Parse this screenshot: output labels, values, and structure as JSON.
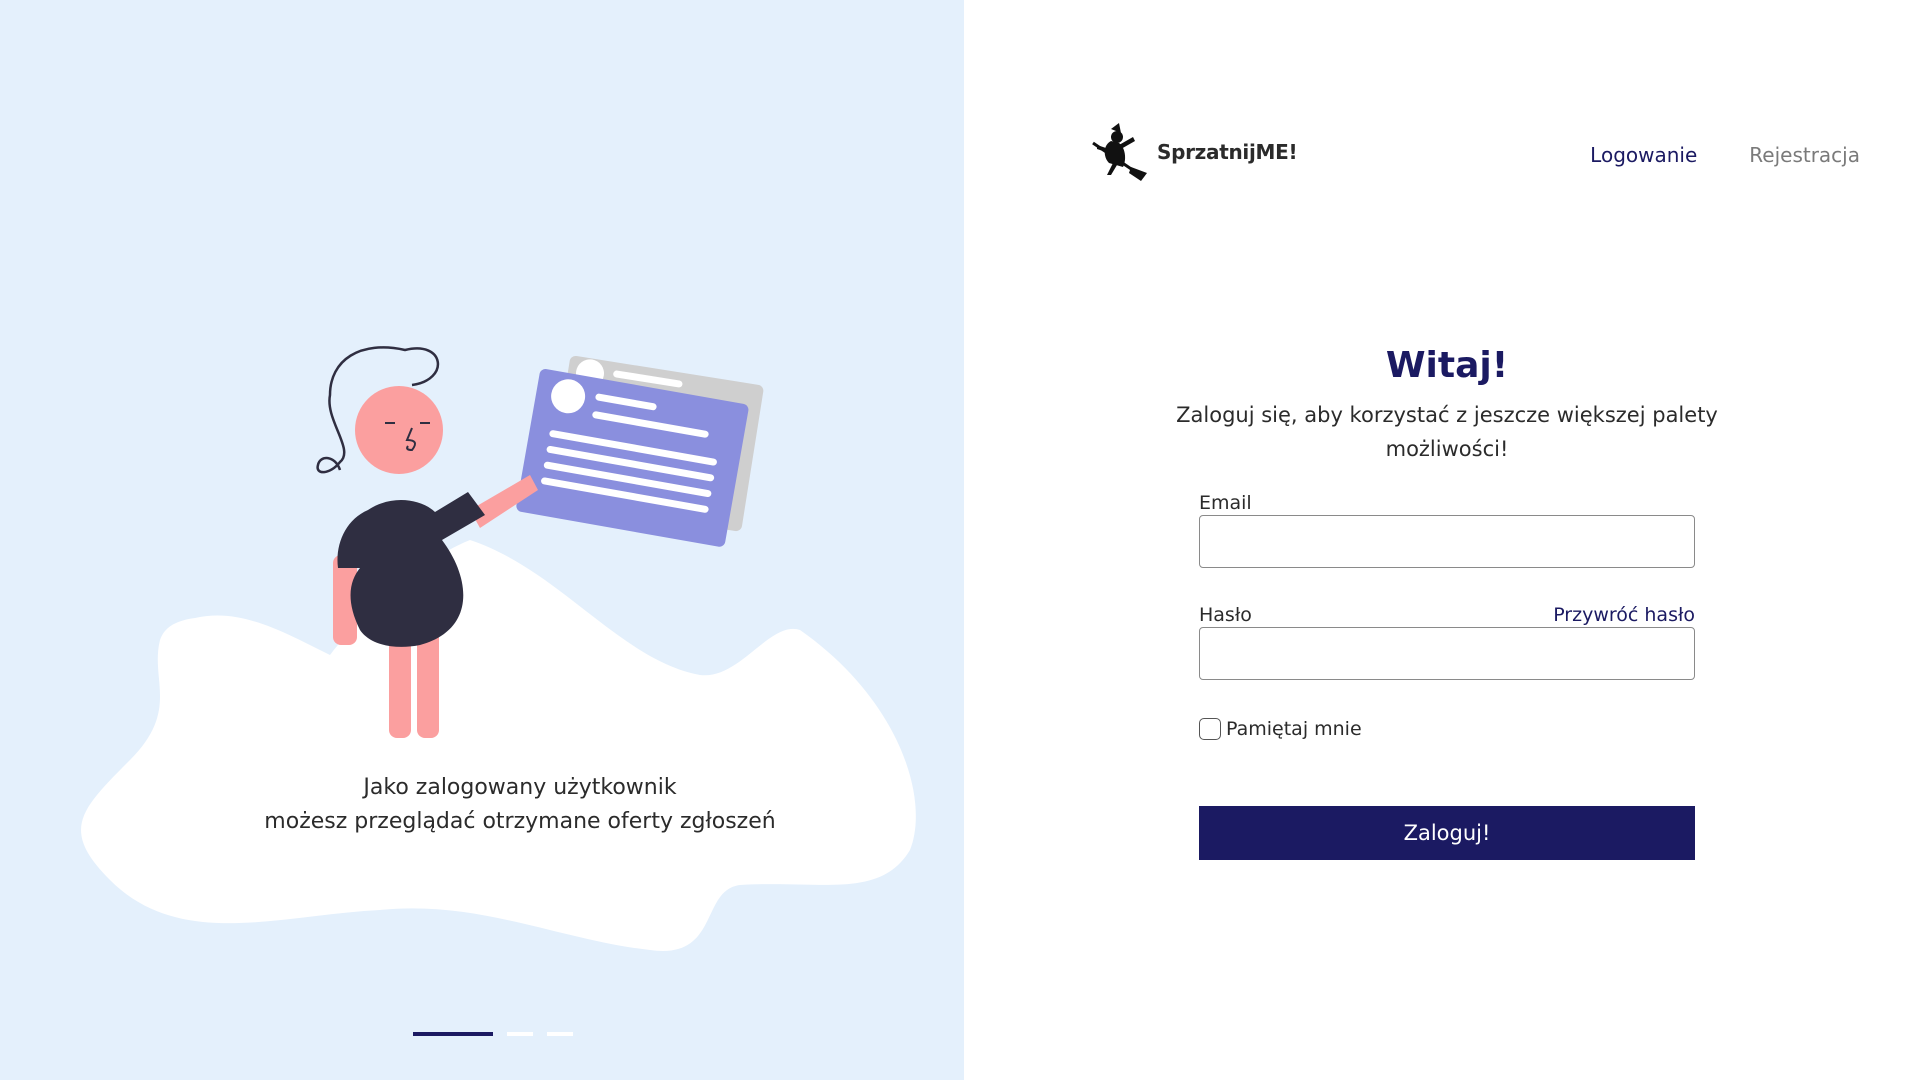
{
  "brand": {
    "logo_icon": "witch-on-broom-icon",
    "name": "SprzatnijME!"
  },
  "nav": {
    "login_label": "Logowanie",
    "register_label": "Rejestracja"
  },
  "hero": {
    "caption_line1": "Jako zalogowany użytkownik",
    "caption_line2": "możesz przeglądać otrzymane oferty zgłoszeń",
    "carousel": {
      "total_slides": 3,
      "active_slide": 1
    }
  },
  "login_form": {
    "title": "Witaj!",
    "subtitle": "Zaloguj się, aby korzystać z jeszcze większej palety możliwości!",
    "email_label": "Email",
    "email_value": "",
    "password_label": "Hasło",
    "password_value": "",
    "forgot_password_label": "Przywróć hasło",
    "remember_me_label": "Pamiętaj mnie",
    "remember_me_checked": false,
    "submit_label": "Zaloguj!"
  },
  "colors": {
    "primary": "#1b1a62",
    "hero_background": "#e4f0fc",
    "illustration_card": "#8a8fde",
    "illustration_skin": "#fb9f9f",
    "illustration_shirt": "#2f2e41"
  }
}
